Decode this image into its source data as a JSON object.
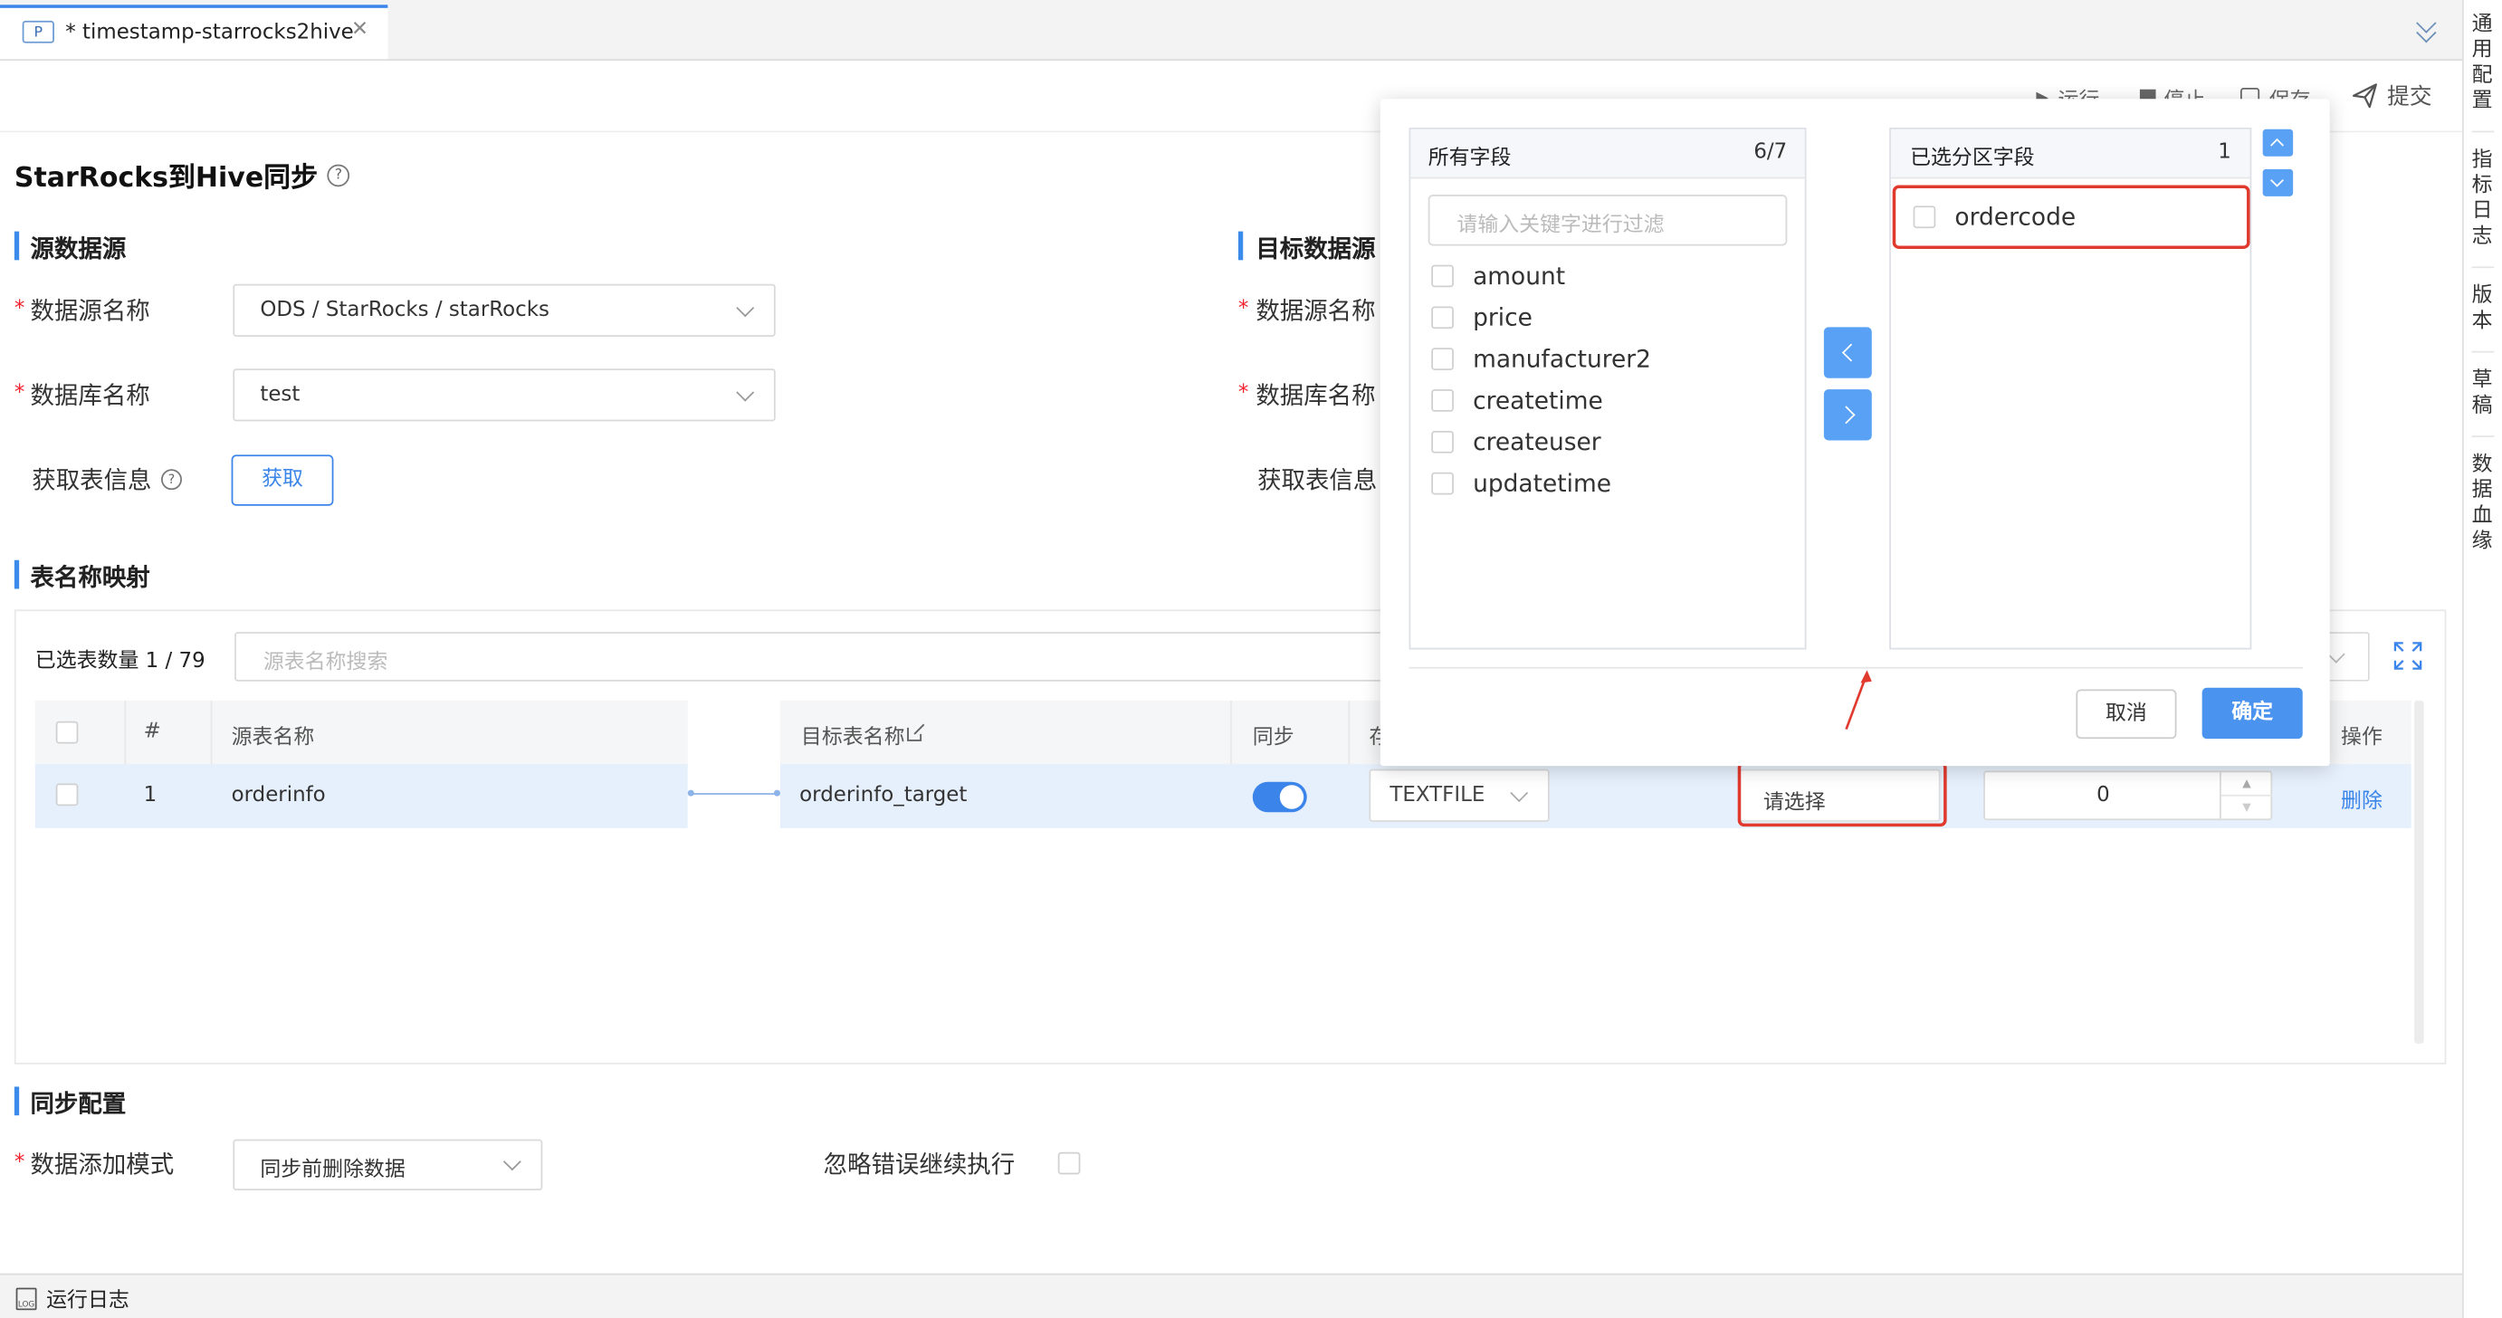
{
  "tab": {
    "badge": "P",
    "title": "* timestamp-starrocks2hive"
  },
  "toolbar": {
    "run": "运行",
    "stop": "停止",
    "save": "保存",
    "submit": "提交"
  },
  "right_sidebar": [
    "通用配置",
    "指标日志",
    "版本",
    "草稿",
    "数据血缘"
  ],
  "page_title": "StarRocks到Hive同步",
  "source": {
    "heading": "源数据源",
    "datasource_label": "数据源名称",
    "datasource_value": "ODS / StarRocks / starRocks",
    "database_label": "数据库名称",
    "database_value": "test",
    "fetch_label": "获取表信息",
    "fetch_button": "获取"
  },
  "target": {
    "heading": "目标数据源",
    "datasource_label": "数据源名称",
    "database_label": "数据库名称",
    "fetch_label": "获取表信息"
  },
  "mapping": {
    "heading": "表名称映射",
    "selected_label": "已选表数量 1 / 79",
    "search_placeholder": "源表名称搜索",
    "left_headers": {
      "no": "#",
      "source": "源表名称"
    },
    "right_headers": {
      "target": "目标表名称",
      "sync": "同步",
      "storage": "存",
      "action": "操作"
    },
    "row": {
      "no": "1",
      "source": "orderinfo",
      "target": "orderinfo_target",
      "storage": "TEXTFILE",
      "partition": "请选择",
      "number": "0",
      "action": "删除"
    }
  },
  "sync_config": {
    "heading": "同步配置",
    "mode_label": "数据添加模式",
    "mode_value": "同步前删除数据",
    "ignore_label": "忽略错误继续执行"
  },
  "bottom": {
    "log": "运行日志",
    "log_icon_text": "LOG"
  },
  "popover": {
    "left_title": "所有字段",
    "left_count": "6/7",
    "filter_placeholder": "请输入关键字进行过滤",
    "fields": [
      "amount",
      "price",
      "manufacturer2",
      "createtime",
      "createuser",
      "updatetime"
    ],
    "right_title": "已选分区字段",
    "right_count": "1",
    "selected": [
      "ordercode"
    ],
    "cancel": "取消",
    "confirm": "确定"
  },
  "colors": {
    "accent": "#3a84ea",
    "highlight": "#e03a2f",
    "row_bg": "#e6f0fc"
  }
}
